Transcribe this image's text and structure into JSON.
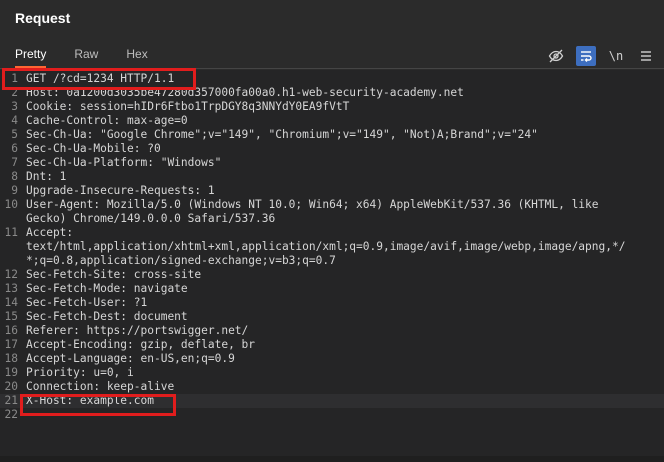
{
  "panel": {
    "title": "Request"
  },
  "tabs": [
    {
      "label": "Pretty",
      "active": true
    },
    {
      "label": "Raw",
      "active": false
    },
    {
      "label": "Hex",
      "active": false
    }
  ],
  "toolbar": {
    "icons": [
      "eye-slash-icon",
      "wrap-lines-icon",
      "newline-icon",
      "menu-icon"
    ],
    "newline_label": "\\n"
  },
  "editor": {
    "lines": [
      {
        "n": "1",
        "text": "GET /?cd=1234 HTTP/1.1"
      },
      {
        "n": "2",
        "text": "Host: 0a1200d3035be47280d357000fa00a0.h1-web-security-academy.net"
      },
      {
        "n": "3",
        "text": "Cookie: session=hIDr6Ftbo1TrpDGY8q3NNYdY0EA9fVtT"
      },
      {
        "n": "4",
        "text": "Cache-Control: max-age=0"
      },
      {
        "n": "5",
        "text": "Sec-Ch-Ua: \"Google Chrome\";v=\"149\", \"Chromium\";v=\"149\", \"Not)A;Brand\";v=\"24\""
      },
      {
        "n": "6",
        "text": "Sec-Ch-Ua-Mobile: ?0"
      },
      {
        "n": "7",
        "text": "Sec-Ch-Ua-Platform: \"Windows\""
      },
      {
        "n": "8",
        "text": "Dnt: 1"
      },
      {
        "n": "9",
        "text": "Upgrade-Insecure-Requests: 1"
      },
      {
        "n": "10",
        "text": "User-Agent: Mozilla/5.0 (Windows NT 10.0; Win64; x64) AppleWebKit/537.36 (KHTML, like"
      },
      {
        "n": "",
        "text": "Gecko) Chrome/149.0.0.0 Safari/537.36"
      },
      {
        "n": "11",
        "text": "Accept:"
      },
      {
        "n": "",
        "text": "text/html,application/xhtml+xml,application/xml;q=0.9,image/avif,image/webp,image/apng,*/"
      },
      {
        "n": "",
        "text": "*;q=0.8,application/signed-exchange;v=b3;q=0.7"
      },
      {
        "n": "12",
        "text": "Sec-Fetch-Site: cross-site"
      },
      {
        "n": "13",
        "text": "Sec-Fetch-Mode: navigate"
      },
      {
        "n": "14",
        "text": "Sec-Fetch-User: ?1"
      },
      {
        "n": "15",
        "text": "Sec-Fetch-Dest: document"
      },
      {
        "n": "16",
        "text": "Referer: https://portswigger.net/"
      },
      {
        "n": "17",
        "text": "Accept-Encoding: gzip, deflate, br"
      },
      {
        "n": "18",
        "text": "Accept-Language: en-US,en;q=0.9"
      },
      {
        "n": "19",
        "text": "Priority: u=0, i"
      },
      {
        "n": "20",
        "text": "Connection: keep-alive"
      },
      {
        "n": "21",
        "text": "X-Host: example.com"
      },
      {
        "n": "22",
        "text": ""
      }
    ]
  },
  "colors": {
    "accent": "#ff6633",
    "highlight_box": "#e11d1d",
    "active_tool": "#3d6ebf"
  }
}
